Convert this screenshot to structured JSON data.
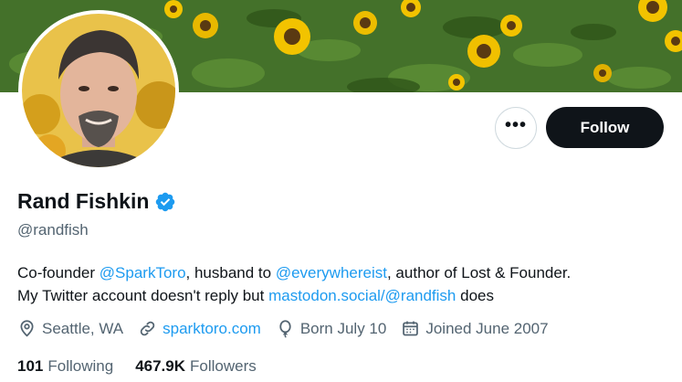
{
  "profile": {
    "display_name": "Rand Fishkin",
    "handle": "@randfish",
    "follow_label": "Follow",
    "more_label": "•••"
  },
  "bio": {
    "part1": "Co-founder ",
    "mention1": "@SparkToro",
    "part2": ", husband to ",
    "mention2": "@everywhereist",
    "part3": ", author of Lost & Founder.",
    "part4": "My Twitter account doesn't reply but ",
    "link1": "mastodon.social/@randfish",
    "part5": " does"
  },
  "meta": {
    "location": "Seattle, WA",
    "website": "sparktoro.com",
    "birthday": "Born July 10",
    "joined": "Joined June 2007"
  },
  "counts": {
    "following_num": "101",
    "following_label": "Following",
    "followers_num": "467.9K",
    "followers_label": "Followers"
  },
  "icons": {
    "verified": "verified-badge-icon",
    "more": "more-horizontal-icon",
    "location": "location-pin-icon",
    "link": "link-icon",
    "birthday": "balloon-icon",
    "calendar": "calendar-icon"
  },
  "colors": {
    "accent": "#1d9bf0",
    "text": "#0f1419",
    "secondary": "#536471",
    "follow_bg": "#0f1419",
    "border": "#cfd9de"
  }
}
